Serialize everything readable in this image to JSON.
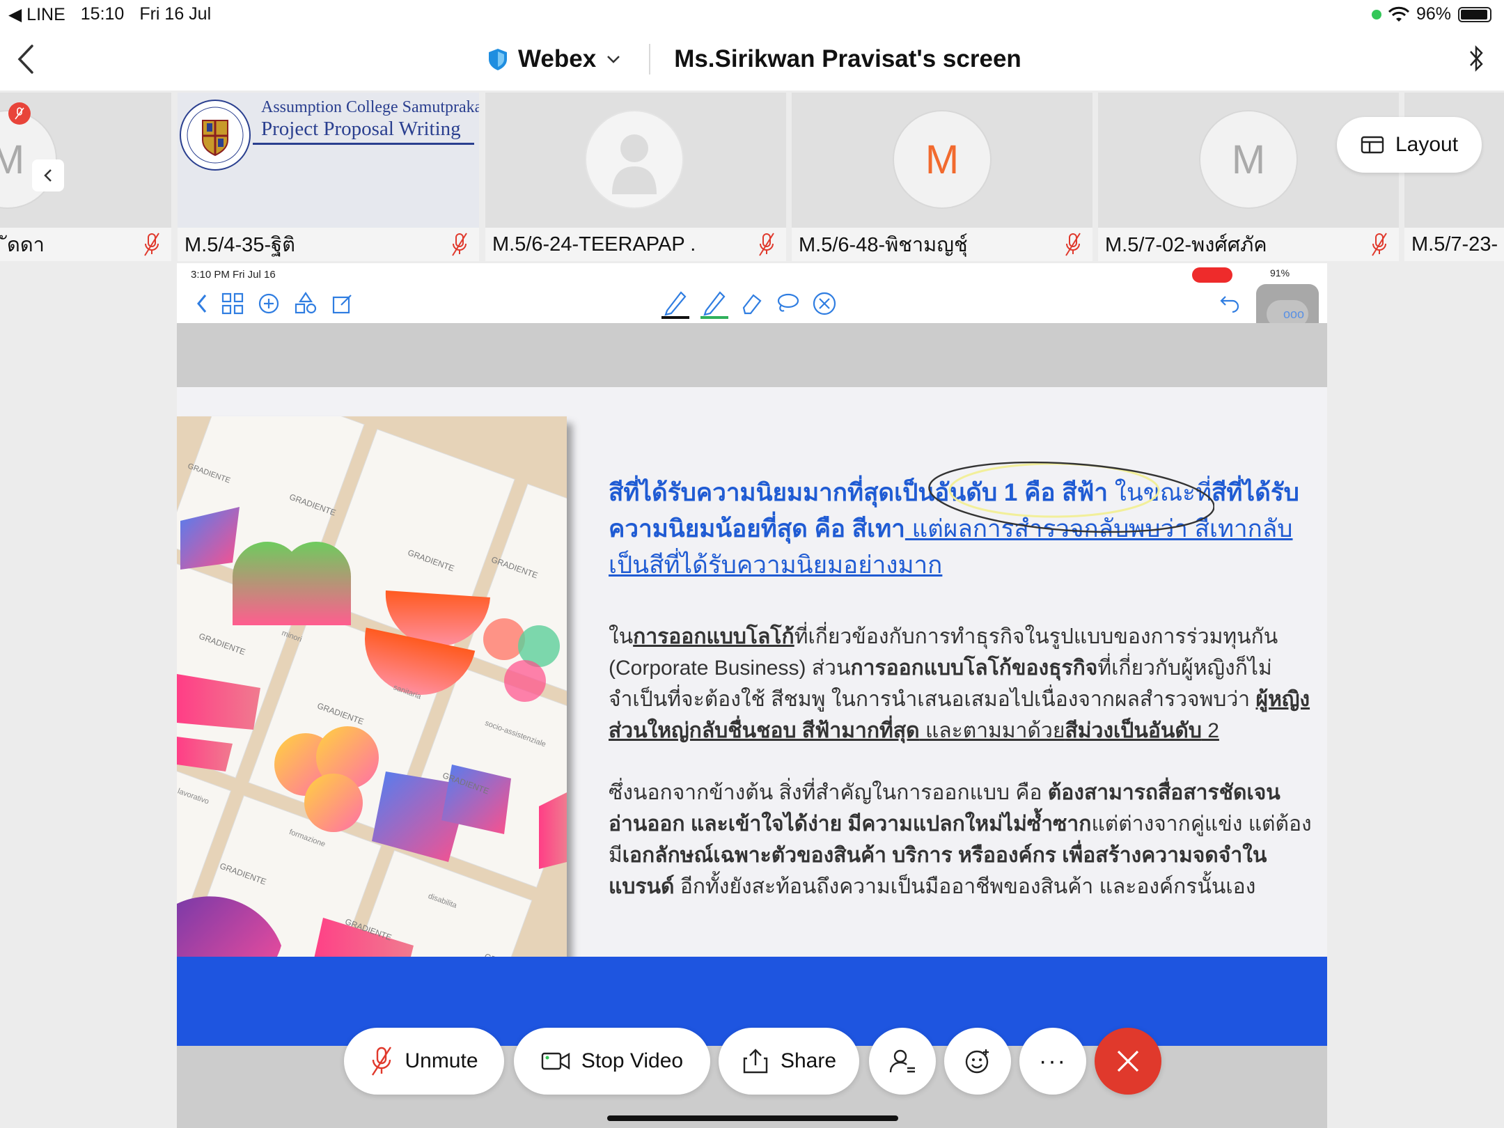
{
  "status_bar": {
    "back_app": "◀ LINE",
    "time": "15:10",
    "date": "Fri 16 Jul",
    "battery": "96%"
  },
  "title_bar": {
    "app_name": "Webex",
    "screen_title": "Ms.Sirikwan Pravisat's screen"
  },
  "participants": [
    {
      "name": "ัดดา",
      "initial": "M",
      "muted": true
    },
    {
      "name": "M.5/4-35-ฐิติ",
      "muted": true,
      "shared_image_title_line1": "Assumption College Samutprakarn",
      "shared_image_title_line2": "Project Proposal Writing"
    },
    {
      "name": "M.5/6-24-TEERAPAP .",
      "muted": true
    },
    {
      "name": "M.5/6-48-พิชามญชุ์",
      "initial": "M",
      "muted": true
    },
    {
      "name": "M.5/7-02-พงศ์ศภัค",
      "initial": "M",
      "muted": true
    },
    {
      "name": "M.5/7-23-",
      "muted": false
    }
  ],
  "layout_button": "Layout",
  "shared_screen": {
    "status_time": "3:10 PM  Fri Jul 16",
    "status_battery": "91%",
    "slide": {
      "p1_a": "สีที่ได้รับความนิยมมากที่สุดเป็นอันดับ 1 คือ สีฟ้า ",
      "p1_b": "ในขณะที่",
      "p1_c": "สีที่ได้รับความนิยมน้อยที่สุด คือ สีเทา",
      "p1_d": " แต่ผลการสำรวจกลับพบว่า สีเทากลับเป็นสีที่ได้รับความนิยมอย่างมาก",
      "p2_a": "ใน",
      "p2_b": "การออกแบบโลโก้",
      "p2_c": "ที่เกี่ยวข้องกับการทำธุรกิจในรูปแบบของการร่วมทุนกัน (Corporate Business) ส่วน",
      "p2_d": "การออกแบบโลโก้ของธุรกิจ",
      "p2_e": "ที่เกี่ยวกับผู้หญิงก็ไม่จำเป็นที่จะต้องใช้ สีชมพู ในการนำเสนอเสมอไปเนื่องจากผลสำรวจพบว่า ",
      "p2_f": "ผู้หญิงส่วนใหญ่กลับชื่นชอบ สีฟ้ามากที่สุด",
      "p2_g": " และตามมาด้วย",
      "p2_h": "สีม่วงเป็นอันดับ",
      "p2_i": " 2",
      "p3_a": "ซึ่งนอกจากข้างต้น สิ่งที่สำคัญในการออกแบบ คือ ",
      "p3_b": "ต้องสามารถสื่อสารชัดเจน อ่านออก และเข้าใจได้ง่าย มีความแปลกใหม่ไม่ซ้ำซาก",
      "p3_c": "แต่ต่างจากคู่แข่ง แต่ต้องมี",
      "p3_d": "เอกลักษณ์เฉพาะตัวของสินค้า บริการ หรือองค์กร เพื่อสร้างความจดจำในแบรนด์",
      "p3_e": " อีกทั้งยังสะท้อนถึงความเป็นมืออาชีพของสินค้า และองค์กรนั้นเอง"
    },
    "photo_card_label": "GRADIENTE",
    "photo_words": [
      "minori",
      "sanitaria",
      "socio-assistenziale",
      "formazione",
      "disabilita",
      "lavorativo"
    ]
  },
  "controls": {
    "unmute": "Unmute",
    "stop_video": "Stop Video",
    "share": "Share",
    "more": "···"
  },
  "colors": {
    "end_call": "#e0392c",
    "slide_blue": "#1e55e0",
    "webex_blue": "#1f8ee0"
  }
}
